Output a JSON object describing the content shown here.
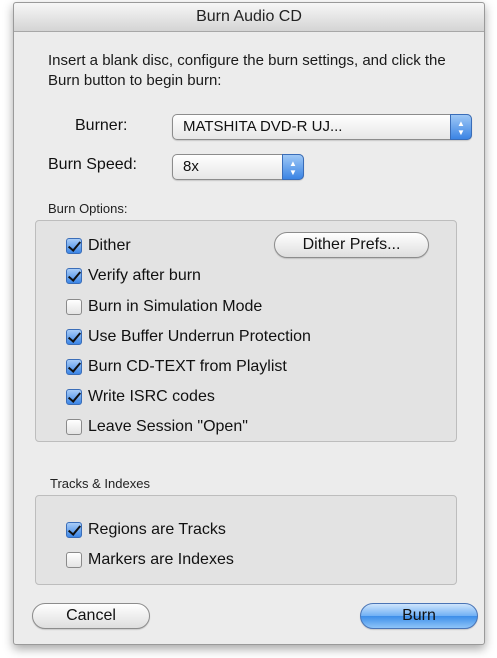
{
  "window": {
    "title": "Burn Audio CD"
  },
  "instructions": "Insert a blank disc, configure the burn settings, and click the Burn button to begin burn:",
  "burner": {
    "label": "Burner:",
    "value": "MATSHITA DVD-R   UJ..."
  },
  "burn_speed": {
    "label": "Burn Speed:",
    "value": "8x"
  },
  "burn_options": {
    "label": "Burn Options:",
    "dither_prefs_button": "Dither Prefs...",
    "items": [
      {
        "label": "Dither",
        "checked": true
      },
      {
        "label": "Verify after burn",
        "checked": true
      },
      {
        "label": "Burn in Simulation Mode",
        "checked": false
      },
      {
        "label": "Use Buffer Underrun Protection",
        "checked": true
      },
      {
        "label": "Burn CD-TEXT from Playlist",
        "checked": true
      },
      {
        "label": "Write ISRC codes",
        "checked": true
      },
      {
        "label": "Leave Session \"Open\"",
        "checked": false
      }
    ]
  },
  "tracks_indexes": {
    "label": "Tracks & Indexes",
    "items": [
      {
        "label": "Regions are Tracks",
        "checked": true
      },
      {
        "label": "Markers are Indexes",
        "checked": false
      }
    ]
  },
  "buttons": {
    "cancel": "Cancel",
    "burn": "Burn"
  },
  "colors": {
    "accent": "#3c86e6",
    "window_bg": "#ececec",
    "group_bg": "#e3e3e3"
  }
}
